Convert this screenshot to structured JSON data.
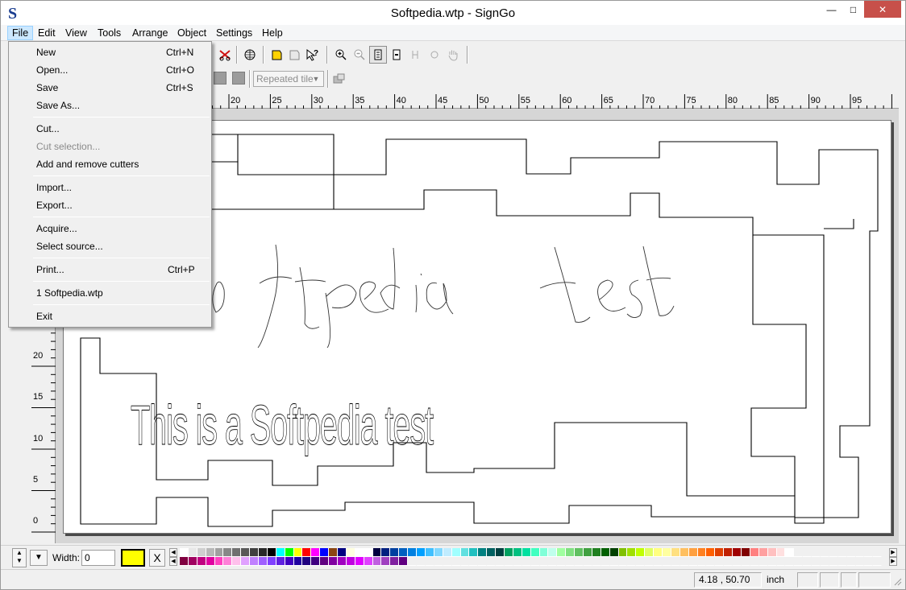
{
  "window": {
    "title": "Softpedia.wtp - SignGo",
    "minimize": "—",
    "maximize": "□",
    "close": "✕"
  },
  "menubar": [
    "File",
    "Edit",
    "View",
    "Tools",
    "Arrange",
    "Object",
    "Settings",
    "Help"
  ],
  "file_menu": {
    "items": [
      {
        "label": "New",
        "shortcut": "Ctrl+N",
        "enabled": true
      },
      {
        "label": "Open...",
        "shortcut": "Ctrl+O",
        "enabled": true
      },
      {
        "label": "Save",
        "shortcut": "Ctrl+S",
        "enabled": true
      },
      {
        "label": "Save As...",
        "shortcut": "",
        "enabled": true
      },
      {
        "label": "Cut...",
        "shortcut": "",
        "enabled": true
      },
      {
        "label": "Cut selection...",
        "shortcut": "",
        "enabled": false
      },
      {
        "label": "Add and remove cutters",
        "shortcut": "",
        "enabled": true
      },
      {
        "label": "Import...",
        "shortcut": "",
        "enabled": true
      },
      {
        "label": "Export...",
        "shortcut": "",
        "enabled": true
      },
      {
        "label": "Acquire...",
        "shortcut": "",
        "enabled": true
      },
      {
        "label": "Select source...",
        "shortcut": "",
        "enabled": true
      },
      {
        "label": "Print...",
        "shortcut": "Ctrl+P",
        "enabled": true
      },
      {
        "label": "1 Softpedia.wtp",
        "shortcut": "",
        "enabled": true
      },
      {
        "label": "Exit",
        "shortcut": "",
        "enabled": true
      }
    ]
  },
  "toolbar": {
    "tile_mode": "Repeated tile"
  },
  "ruler": {
    "top_labels": [
      "20",
      "25",
      "30",
      "35",
      "40",
      "45",
      "50",
      "55",
      "60",
      "65",
      "70",
      "75",
      "80",
      "85",
      "90",
      "95"
    ],
    "left_labels": [
      "20",
      "15",
      "10",
      "5",
      "0"
    ]
  },
  "canvas": {
    "handwritten_text": "oftpedia test",
    "outline_text": "This is a Softpedia test"
  },
  "bottom": {
    "width_label": "Width:",
    "width_value": "0",
    "current_color": "#ffff00",
    "clear_label": "X"
  },
  "status": {
    "coords": "4.18 , 50.70",
    "unit": "inch"
  },
  "palette_row1": [
    "#ffffff",
    "#e8e8e8",
    "#d0d0d0",
    "#b8b8b8",
    "#a0a0a0",
    "#888888",
    "#707070",
    "#585858",
    "#404040",
    "#282828",
    "#000000",
    "#00ffff",
    "#00ff00",
    "#ffff00",
    "#ff0000",
    "#ff00ff",
    "#0000ff",
    "#8b4513",
    "#000080",
    "#ffffe0",
    "#ffffff",
    "#ffffff",
    "#000040",
    "#002080",
    "#0040a0",
    "#0060c0",
    "#0080e0",
    "#00a0ff",
    "#40c0ff",
    "#80d8ff",
    "#c0ecff",
    "#a0ffff",
    "#60e0e0",
    "#20c0c0",
    "#008080",
    "#006060",
    "#004040",
    "#00a060",
    "#00c080",
    "#00e0a0",
    "#40ffc0",
    "#80ffd8",
    "#c0ffec",
    "#a0ffa0",
    "#80e080",
    "#60c060",
    "#40a040",
    "#208020",
    "#006000",
    "#004000",
    "#80c000",
    "#a0e000",
    "#c0ff00",
    "#e0ff60",
    "#ffff80",
    "#ffffa0",
    "#ffe080",
    "#ffc060",
    "#ffa040",
    "#ff8020",
    "#ff6000",
    "#e04000",
    "#c02000",
    "#a00000",
    "#800000",
    "#ff8080",
    "#ffa0a0",
    "#ffc0c0",
    "#ffe0e0",
    "#ffffff"
  ],
  "palette_row2": [
    "#800040",
    "#a00060",
    "#c00080",
    "#e000a0",
    "#ff40c0",
    "#ff80d8",
    "#ffc0ec",
    "#e0a0ff",
    "#c080ff",
    "#a060ff",
    "#8040ff",
    "#6020e0",
    "#4000c0",
    "#2000a0",
    "#200080",
    "#400080",
    "#600080",
    "#8000a0",
    "#a000c0",
    "#c000e0",
    "#e000ff",
    "#e040ff",
    "#c060e0",
    "#a040c0",
    "#8020a0",
    "#600080"
  ]
}
